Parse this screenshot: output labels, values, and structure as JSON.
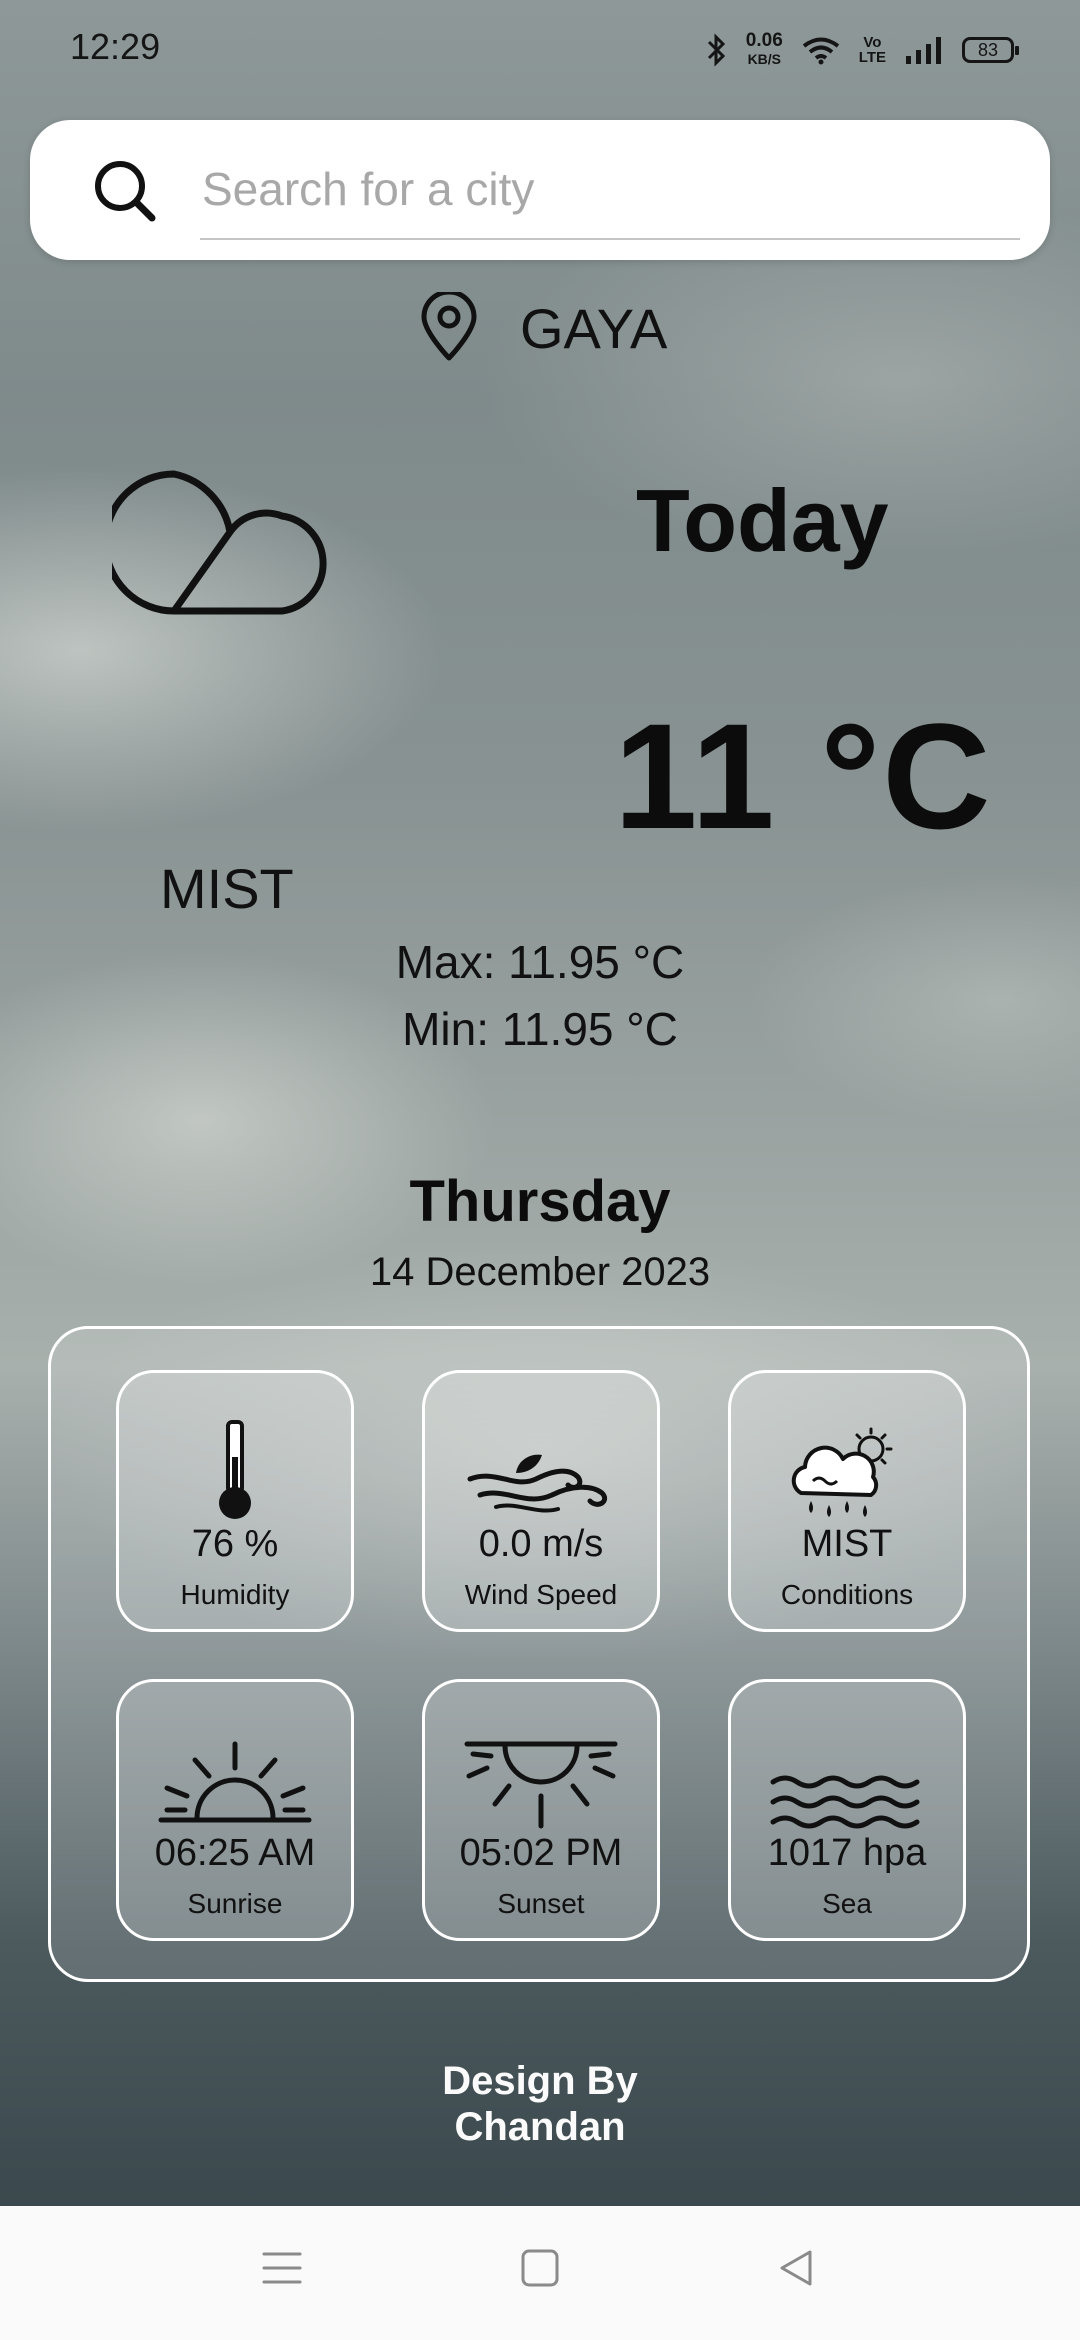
{
  "status_bar": {
    "time": "12:29",
    "net_speed_value": "0.06",
    "net_speed_unit": "KB/S",
    "volte_top": "Vo",
    "volte_bottom": "LTE",
    "battery": "83"
  },
  "search": {
    "placeholder": "Search for a city",
    "icon": "search-icon"
  },
  "location": {
    "icon": "location-pin-icon",
    "city": "GAYA"
  },
  "weather": {
    "icon": "cloud-icon",
    "day_label": "Today",
    "temperature": "11 °C",
    "condition": "MIST",
    "max": "Max: 11.95 °C",
    "min": "Min: 11.95 °C",
    "weekday": "Thursday",
    "date": "14 December 2023"
  },
  "details": [
    {
      "icon": "thermometer-icon",
      "value": "76 %",
      "label": "Humidity"
    },
    {
      "icon": "wind-icon",
      "value": "0.0 m/s",
      "label": "Wind Speed"
    },
    {
      "icon": "cloud-sun-rain-icon",
      "value": "MIST",
      "label": "Conditions"
    },
    {
      "icon": "sunrise-icon",
      "value": "06:25 AM",
      "label": "Sunrise"
    },
    {
      "icon": "sunset-icon",
      "value": "05:02 PM",
      "label": "Sunset"
    },
    {
      "icon": "waves-icon",
      "value": "1017 hpa",
      "label": "Sea"
    }
  ],
  "footer": {
    "line1": "Design By",
    "line2": "Chandan"
  },
  "nav_bar": {
    "menu_icon": "menu-icon",
    "home_icon": "home-square-icon",
    "back_icon": "back-triangle-icon"
  }
}
